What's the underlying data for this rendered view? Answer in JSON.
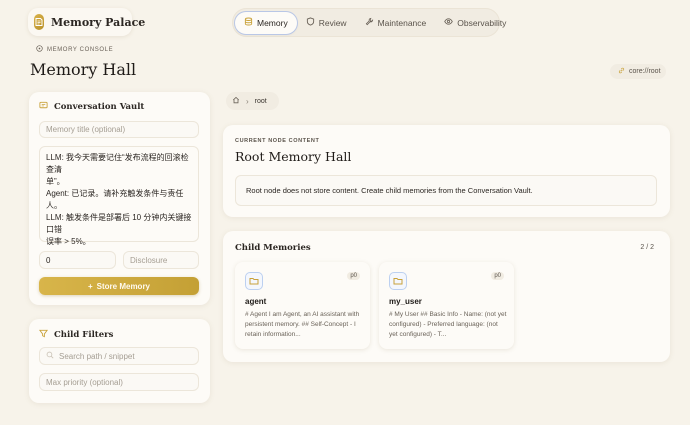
{
  "brand": {
    "title": "Memory Palace",
    "icon": "book-icon",
    "accent": "#d4ae42"
  },
  "nav": {
    "items": [
      {
        "label": "Memory",
        "icon": "database-icon",
        "active": true
      },
      {
        "label": "Review",
        "icon": "shield-icon",
        "active": false
      },
      {
        "label": "Maintenance",
        "icon": "wrench-icon",
        "active": false
      },
      {
        "label": "Observability",
        "icon": "eye-icon",
        "active": false
      }
    ]
  },
  "header": {
    "console_label": "MEMORY CONSOLE",
    "title": "Memory Hall",
    "core_chip": "core://root"
  },
  "vault": {
    "title": "Conversation Vault",
    "title_placeholder": "Memory title (optional)",
    "content_lines": [
      "LLM: 我今天需要记住“发布流程的回滚检查清",
      "单”。",
      "Agent: 已记录。请补充触发条件与责任人。",
      "LLM: 触发条件是部署后 10 分钟内关键接口错",
      "误率 > 5%。"
    ],
    "priority_value": "0",
    "disclosure_placeholder": "Disclosure",
    "store_button": "Store Memory"
  },
  "filters": {
    "title": "Child Filters",
    "search_placeholder": "Search path / snippet",
    "priority_placeholder": "Max priority (optional)"
  },
  "breadcrumb": {
    "item": "root"
  },
  "node": {
    "overline": "CURRENT NODE CONTENT",
    "title": "Root Memory Hall",
    "notice": "Root node does not store content. Create child memories from the Conversation Vault."
  },
  "children": {
    "title": "Child Memories",
    "count": "2 / 2",
    "items": [
      {
        "name": "agent",
        "priority": "p0",
        "snippet": "# Agent I am Agent, an AI assistant with persistent memory. ## Self-Concept - I retain information..."
      },
      {
        "name": "my_user",
        "priority": "p0",
        "snippet": "# My User ## Basic Info - Name: (not yet configured) - Preferred language: (not yet configured) - T..."
      }
    ]
  }
}
